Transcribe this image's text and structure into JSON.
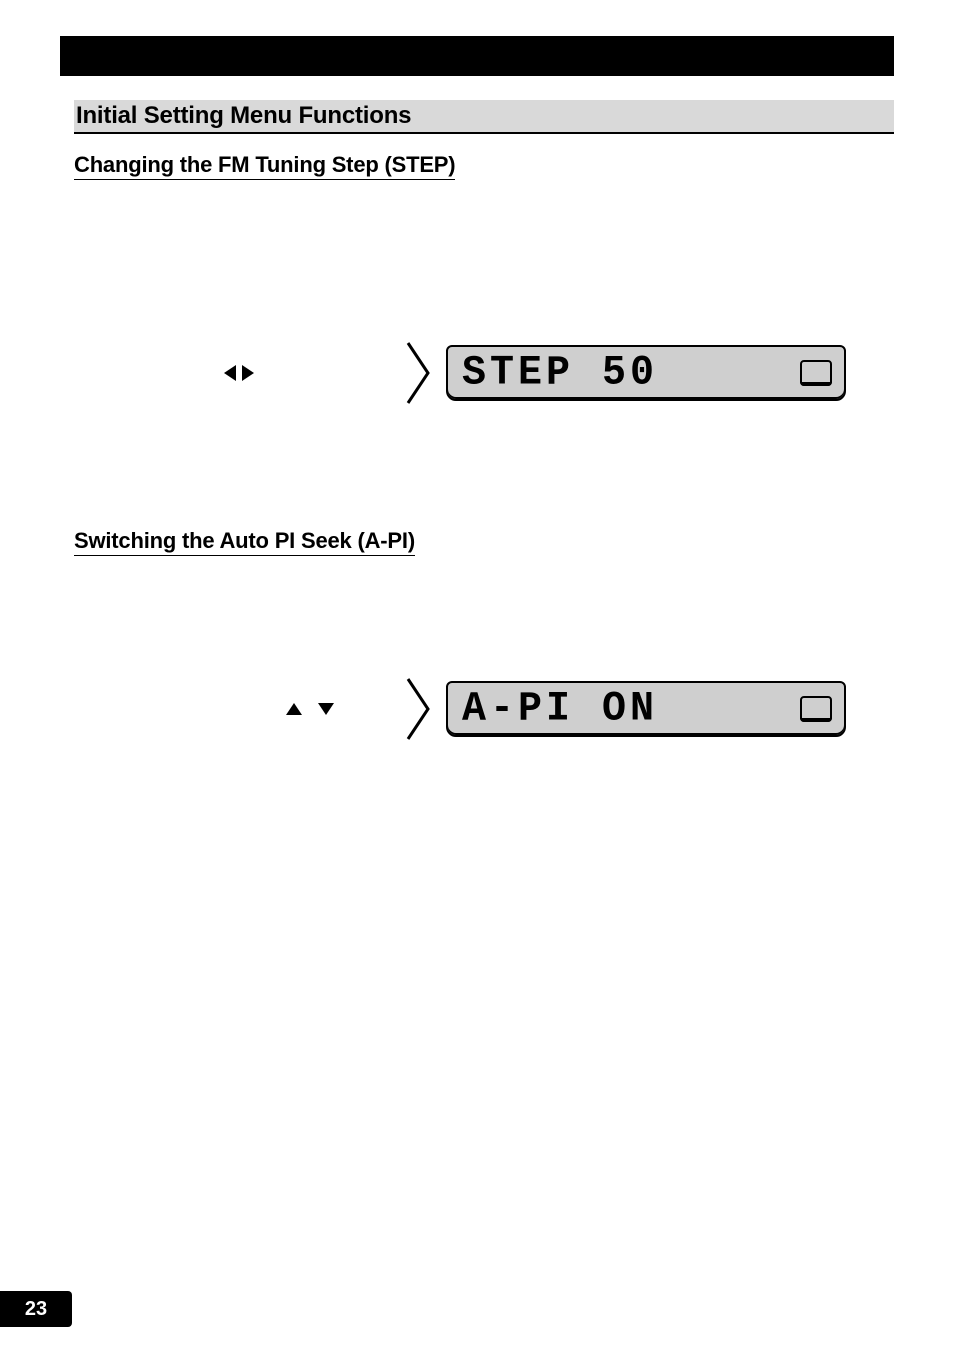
{
  "page": {
    "number": "23",
    "section_heading": "Initial Setting Menu Functions"
  },
  "step_section": {
    "heading": "Changing the FM Tuning Step (STEP)",
    "arrow_hint_left": "left-arrow",
    "arrow_hint_right": "right-arrow",
    "lcd_text": "STEP 50"
  },
  "api_section": {
    "heading": "Switching the Auto PI Seek (A-PI)",
    "arrow_hint_up": "up-arrow",
    "arrow_hint_down": "down-arrow",
    "lcd_text": "A-PI ON"
  }
}
